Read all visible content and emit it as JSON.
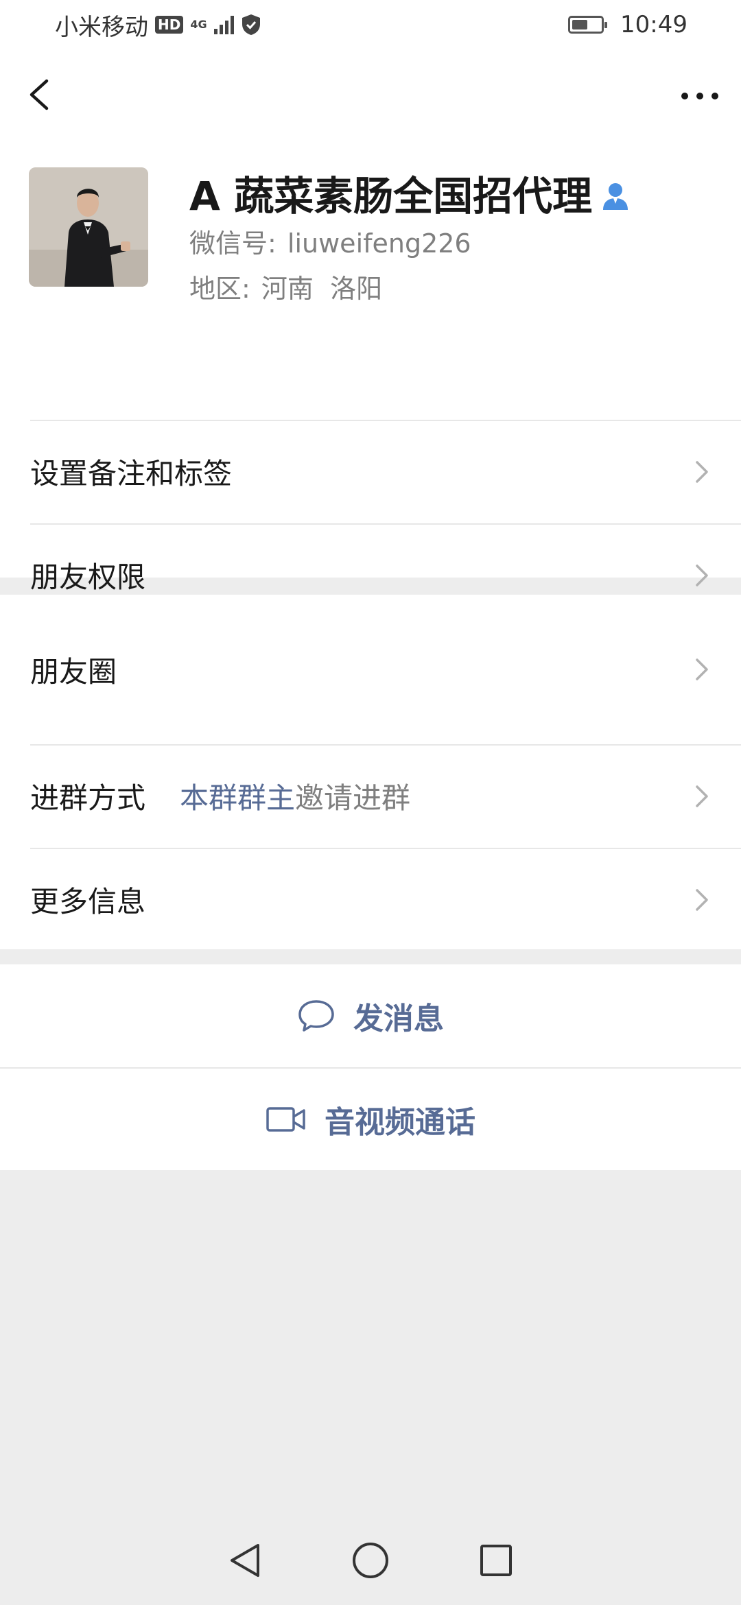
{
  "status_bar": {
    "carrier": "小米移动",
    "hd_badge": "HD",
    "network": "4G",
    "time": "10:49"
  },
  "profile": {
    "name": "A 蔬菜素肠全国招代理",
    "wechat_id_label": "微信号:",
    "wechat_id": "liuweifeng226",
    "region_label": "地区:",
    "region": "河南  洛阳"
  },
  "menu": {
    "remark_tags": "设置备注和标签",
    "friend_permissions": "朋友权限",
    "moments": "朋友圈",
    "join_method_label": "进群方式",
    "join_method_highlight": "本群群主",
    "join_method_rest": "邀请进群",
    "more_info": "更多信息"
  },
  "actions": {
    "send_message": "发消息",
    "video_call": "音视频通话"
  },
  "colors": {
    "link": "#576b95",
    "gender_icon": "#4a90e2",
    "background": "#ededed"
  }
}
